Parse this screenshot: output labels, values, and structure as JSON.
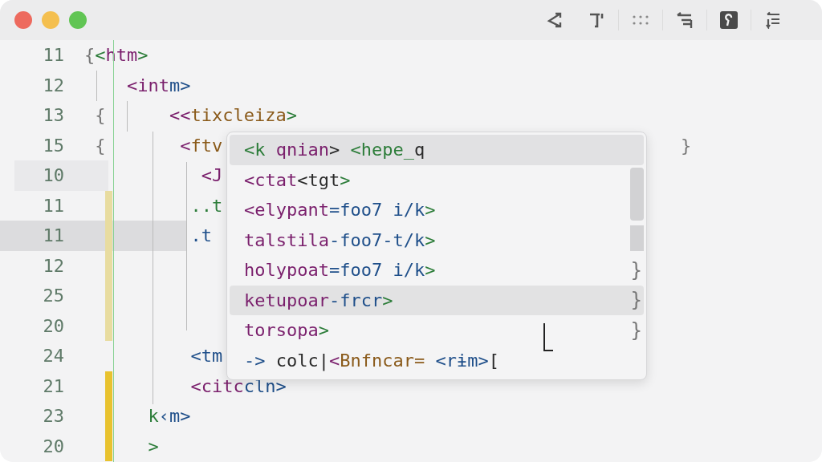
{
  "editor": {
    "lines": [
      {
        "number": "11",
        "current": false,
        "highlighted": false,
        "modified": false,
        "added": false,
        "tokens": [
          {
            "text": "{",
            "kind": "brace"
          },
          {
            "text": "<",
            "kind": "punct"
          },
          {
            "text": "htm",
            "kind": "tag"
          },
          {
            "text": ">",
            "kind": "punct"
          }
        ]
      },
      {
        "number": "12",
        "current": false,
        "highlighted": false,
        "modified": false,
        "added": false,
        "tokens": [
          {
            "text": "    <int",
            "kind": "tag"
          },
          {
            "text": "m>",
            "kind": "name"
          }
        ]
      },
      {
        "number": "13",
        "current": false,
        "highlighted": false,
        "modified": false,
        "added": false,
        "tokens": [
          {
            "text": " {",
            "kind": "brace"
          },
          {
            "text": "      <<",
            "kind": "tag"
          },
          {
            "text": "tixcleiza",
            "kind": "attr"
          },
          {
            "text": ">",
            "kind": "punct"
          }
        ]
      },
      {
        "number": "15",
        "current": false,
        "highlighted": false,
        "modified": false,
        "added": false,
        "trail": "}",
        "tokens": [
          {
            "text": " {",
            "kind": "brace"
          },
          {
            "text": "       <",
            "kind": "tag"
          },
          {
            "text": "ftv",
            "kind": "attr"
          }
        ]
      },
      {
        "number": "10",
        "current": false,
        "highlighted": true,
        "modified": false,
        "added": false,
        "tokens": [
          {
            "text": "           <J",
            "kind": "tag"
          }
        ]
      },
      {
        "number": "11",
        "current": false,
        "highlighted": false,
        "modified": true,
        "added": false,
        "tokens": [
          {
            "text": "          ..t",
            "kind": "punct"
          }
        ]
      },
      {
        "number": "11",
        "current": true,
        "highlighted": false,
        "modified": true,
        "added": false,
        "tokens": [
          {
            "text": "          .t",
            "kind": "name"
          }
        ]
      },
      {
        "number": "12",
        "current": false,
        "highlighted": false,
        "modified": true,
        "added": false
      },
      {
        "number": "25",
        "current": false,
        "highlighted": false,
        "modified": true,
        "added": false
      },
      {
        "number": "20",
        "current": false,
        "highlighted": false,
        "modified": true,
        "added": false
      },
      {
        "number": "24",
        "current": false,
        "highlighted": false,
        "modified": false,
        "added": false,
        "tokens": [
          {
            "text": "          <tm",
            "kind": "name"
          }
        ]
      },
      {
        "number": "21",
        "current": false,
        "highlighted": false,
        "modified": false,
        "added": true,
        "tokens": [
          {
            "text": "          <citc",
            "kind": "tag"
          },
          {
            "text": "cln>",
            "kind": "name"
          }
        ]
      },
      {
        "number": "23",
        "current": false,
        "highlighted": false,
        "modified": false,
        "added": true,
        "tokens": [
          {
            "text": "      k",
            "kind": "punct"
          },
          {
            "text": "‹m>",
            "kind": "name"
          }
        ]
      },
      {
        "number": "20",
        "current": false,
        "highlighted": false,
        "modified": false,
        "added": true,
        "tokens": [
          {
            "text": "      >",
            "kind": "punct"
          }
        ]
      }
    ]
  },
  "completion": {
    "items": [
      {
        "selected": true,
        "hovered": false,
        "tokens": [
          {
            "text": "<k ",
            "kind": "punct"
          },
          {
            "text": "qnian",
            "kind": "tag"
          },
          {
            "text": "> ",
            "kind": "plain"
          },
          {
            "text": "<hepe_",
            "kind": "punct"
          },
          {
            "text": "q",
            "kind": "plain"
          }
        ]
      },
      {
        "selected": false,
        "hovered": false,
        "tokens": [
          {
            "text": "<ctat",
            "kind": "tag"
          },
          {
            "text": "<tgt",
            "kind": "plain"
          },
          {
            "text": ">",
            "kind": "punct"
          }
        ]
      },
      {
        "selected": false,
        "hovered": false,
        "tokens": [
          {
            "text": "<elypant",
            "kind": "tag"
          },
          {
            "text": "=foo7 i/k",
            "kind": "name"
          },
          {
            "text": ">",
            "kind": "punct"
          }
        ]
      },
      {
        "selected": false,
        "hovered": false,
        "tokens": [
          {
            "text": "talstila",
            "kind": "tag"
          },
          {
            "text": "-foo7-t/k",
            "kind": "name"
          },
          {
            "text": ">",
            "kind": "punct"
          }
        ]
      },
      {
        "selected": false,
        "hovered": false,
        "trail": "}",
        "tokens": [
          {
            "text": "holypoat",
            "kind": "tag"
          },
          {
            "text": "=foo7 i/k",
            "kind": "name"
          },
          {
            "text": ">",
            "kind": "punct"
          }
        ]
      },
      {
        "selected": false,
        "hovered": true,
        "trail": "}",
        "tokens": [
          {
            "text": "ketupoar",
            "kind": "tag"
          },
          {
            "text": "-frcr",
            "kind": "name"
          },
          {
            "text": ">",
            "kind": "punct"
          }
        ]
      },
      {
        "selected": false,
        "hovered": false,
        "trail": "}",
        "tokens": [
          {
            "text": "torsopa",
            "kind": "tag"
          },
          {
            "text": ">",
            "kind": "punct"
          }
        ]
      },
      {
        "selected": false,
        "hovered": false,
        "tokens": [
          {
            "text": "-> ",
            "kind": "name"
          },
          {
            "text": "colc|",
            "kind": "plain"
          },
          {
            "text": "<",
            "kind": "tag"
          },
          {
            "text": "Bnfncar= ",
            "kind": "attr"
          },
          {
            "text": "<rɨm>",
            "kind": "name"
          },
          {
            "text": "[",
            "kind": "plain"
          }
        ]
      }
    ]
  }
}
